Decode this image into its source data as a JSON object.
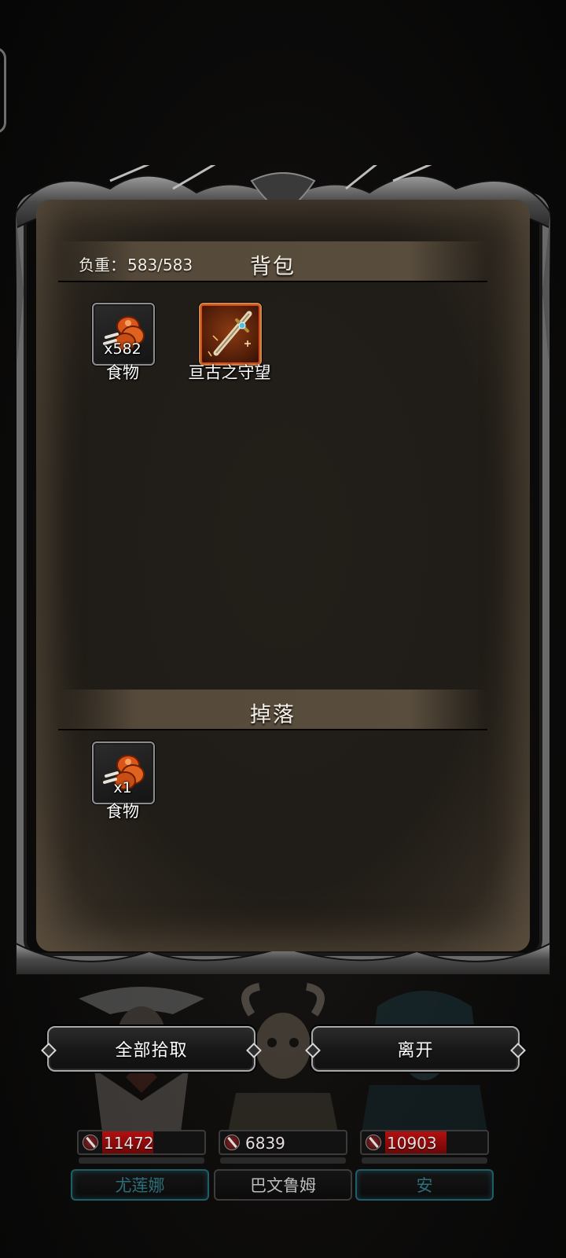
{
  "inventory": {
    "weight_label": "负重：",
    "weight_value": "583/583",
    "title": "背包",
    "items": [
      {
        "name": "食物",
        "quantity": "x582",
        "icon": "meat-icon",
        "rarity": "common"
      },
      {
        "name": "亘古之守望",
        "quantity": "",
        "icon": "sword-icon",
        "rarity": "legendary"
      }
    ]
  },
  "loot": {
    "title": "掉落",
    "items": [
      {
        "name": "食物",
        "quantity": "x1",
        "icon": "meat-icon",
        "rarity": "common"
      }
    ]
  },
  "actions": {
    "pick_all_label": "全部拾取",
    "leave_label": "离开"
  },
  "party": [
    {
      "name": "尤莲娜",
      "hp": "11472",
      "hp_fill_fraction": 0.5,
      "active": true
    },
    {
      "name": "巴文鲁姆",
      "hp": "6839",
      "hp_fill_fraction": 0.0,
      "active": false
    },
    {
      "name": "安",
      "hp": "10903",
      "hp_fill_fraction": 0.6,
      "active": true
    }
  ],
  "colors": {
    "accent_red": "#b21010",
    "legendary_border": "#e04a16",
    "active_plate": "#1f5d68"
  }
}
